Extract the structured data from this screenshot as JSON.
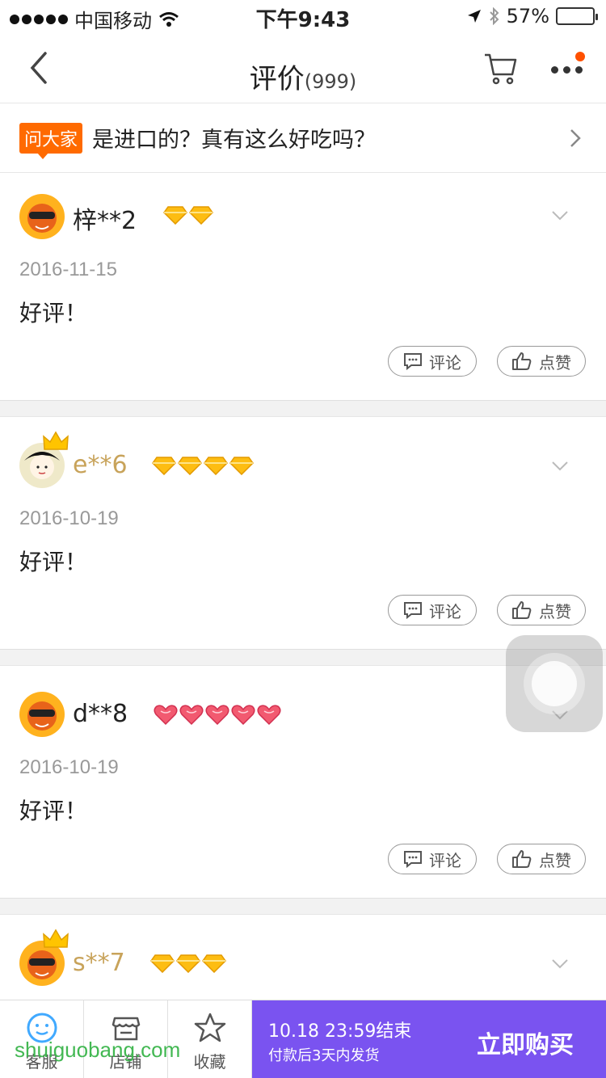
{
  "status_bar": {
    "carrier": "中国移动",
    "time": "下午9:43",
    "battery": "57%",
    "battery_level": 0.57
  },
  "nav": {
    "title": "评价",
    "count": "(999)"
  },
  "ask": {
    "badge": "问大家",
    "question": "是进口的？真有这么好吃吗？"
  },
  "reviews": [
    {
      "user": "梓**2",
      "date": "2016-11-15",
      "content": "好评！",
      "level_icon": "yellow-diamond-icon",
      "level_count": 2
    },
    {
      "user": "e**6",
      "date": "2016-10-19",
      "content": "好评！",
      "level_icon": "yellow-diamond-icon",
      "level_count": 4
    },
    {
      "user": "d**8",
      "date": "2016-10-19",
      "content": "好评！",
      "level_icon": "red-heart-icon",
      "level_count": 5
    },
    {
      "user": "s**7",
      "date": "",
      "content": "",
      "level_icon": "yellow-diamond-icon",
      "level_count": 3
    }
  ],
  "actions": {
    "comment": "评论",
    "like": "点赞"
  },
  "bottom": {
    "tabs": [
      "客服",
      "店铺",
      "收藏"
    ],
    "promo_line1": "10.18 23:59结束",
    "promo_line2": "付款后3天内发货",
    "buy": "立即购买"
  },
  "watermark": "shuiguobang.com",
  "colors": {
    "accent": "#ff5000",
    "promo": "#7a53f0",
    "gold_username": "#c8a35a"
  }
}
